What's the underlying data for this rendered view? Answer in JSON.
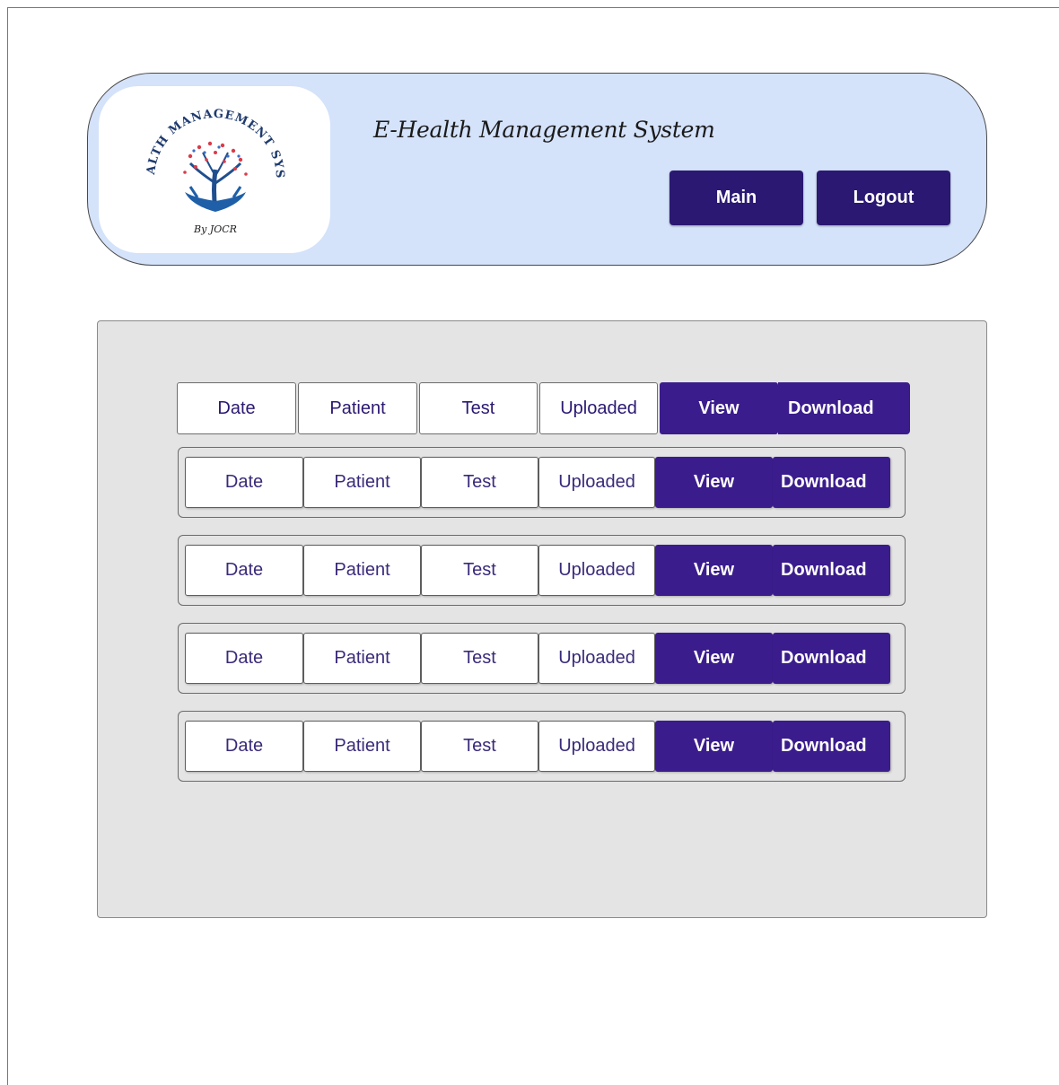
{
  "header": {
    "title": "E-Health Management System",
    "logo_text_top": "E-HEALTH MANAGEMENT SYSTEM",
    "logo_text_bottom": "By JOCR",
    "main_label": "Main",
    "logout_label": "Logout"
  },
  "columns": {
    "date": "Date",
    "patient": "Patient",
    "test": "Test",
    "uploaded": "Uploaded",
    "view": "View",
    "download": "Download"
  },
  "records": [
    {
      "date": "Date",
      "patient": "Patient",
      "test": "Test",
      "uploaded": "Uploaded",
      "view": "View",
      "download": "Download"
    },
    {
      "date": "Date",
      "patient": "Patient",
      "test": "Test",
      "uploaded": "Uploaded",
      "view": "View",
      "download": "Download"
    },
    {
      "date": "Date",
      "patient": "Patient",
      "test": "Test",
      "uploaded": "Uploaded",
      "view": "View",
      "download": "Download"
    },
    {
      "date": "Date",
      "patient": "Patient",
      "test": "Test",
      "uploaded": "Uploaded",
      "view": "View",
      "download": "Download"
    }
  ],
  "colors": {
    "accent": "#3a1c8c",
    "header_bg": "#d4e2fa",
    "panel_bg": "#e4e4e4"
  },
  "icons": {
    "logo": "tree-hands-logo"
  }
}
